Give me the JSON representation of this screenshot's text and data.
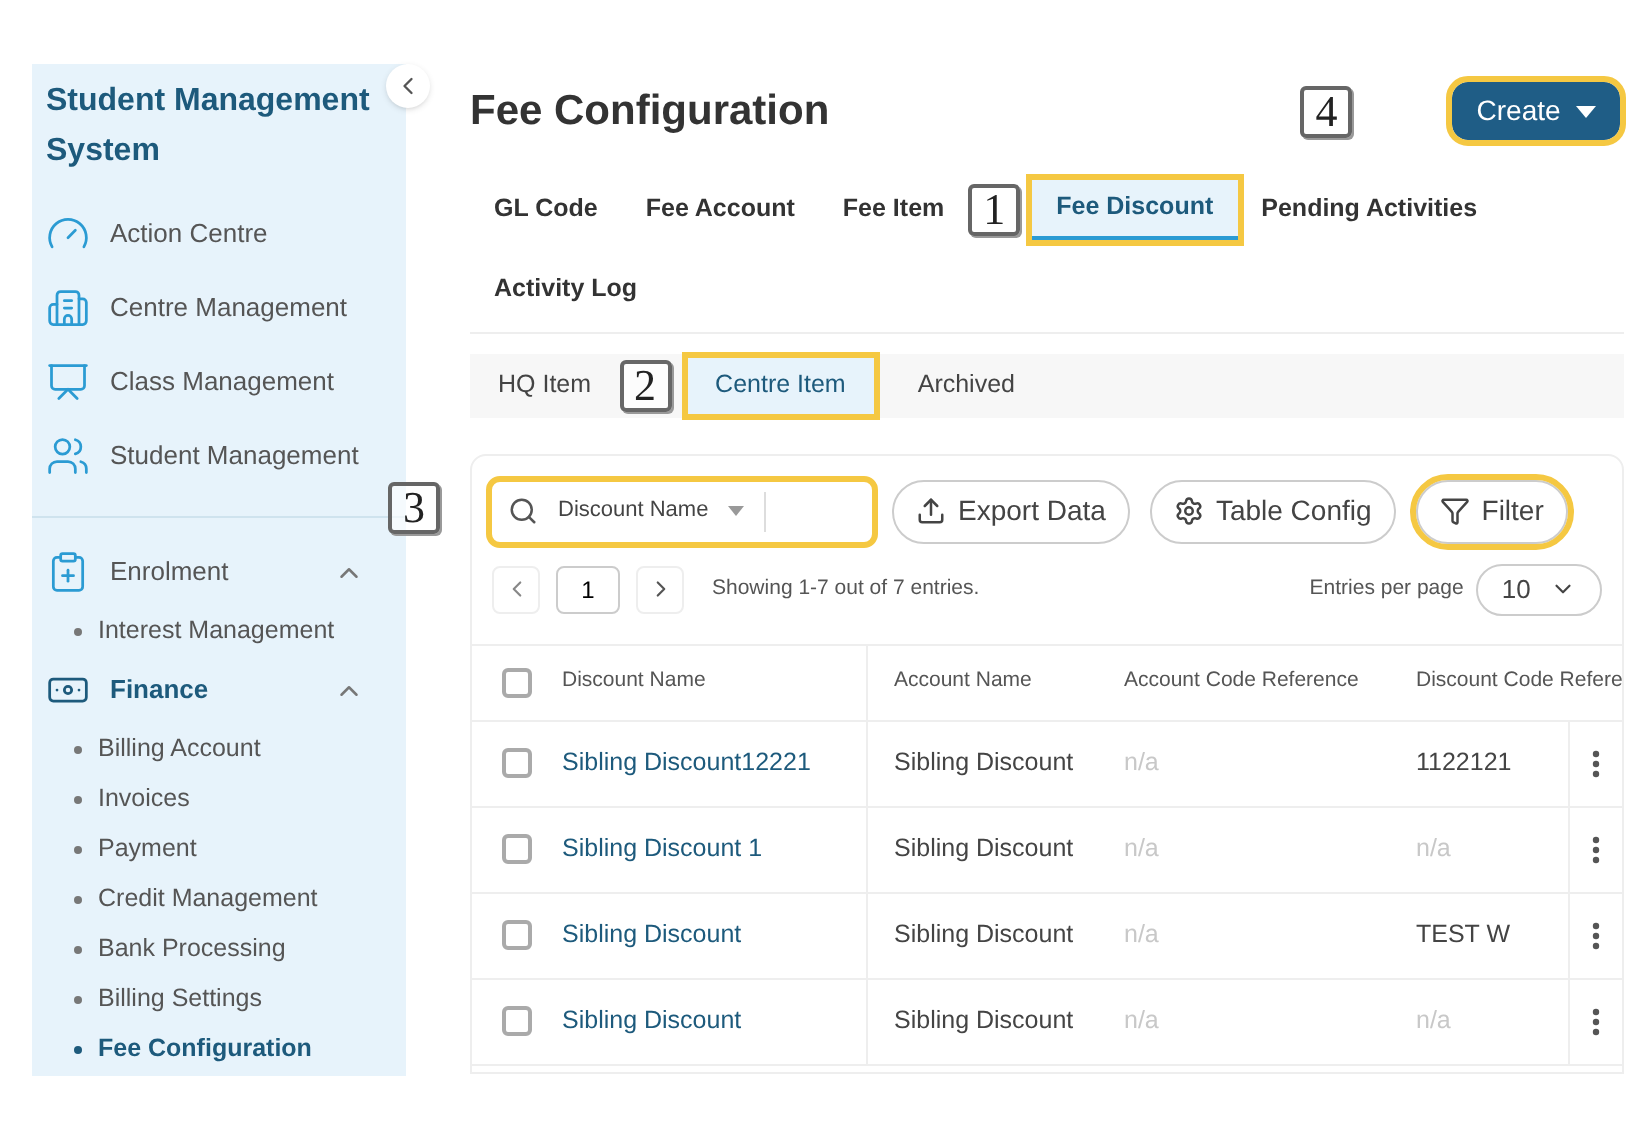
{
  "sidebar": {
    "title": "Student Management System",
    "items": [
      {
        "label": "Action Centre",
        "selected": false
      },
      {
        "label": "Centre Management",
        "selected": false
      },
      {
        "label": "Class Management",
        "selected": false
      },
      {
        "label": "Student Management",
        "selected": false
      }
    ],
    "groups": [
      {
        "label": "Enrolment",
        "selected": false,
        "expanded": true,
        "children": [
          {
            "label": "Interest Management",
            "selected": false
          }
        ]
      },
      {
        "label": "Finance",
        "selected": true,
        "expanded": true,
        "children": [
          {
            "label": "Billing Account",
            "selected": false
          },
          {
            "label": "Invoices",
            "selected": false
          },
          {
            "label": "Payment",
            "selected": false
          },
          {
            "label": "Credit Management",
            "selected": false
          },
          {
            "label": "Bank Processing",
            "selected": false
          },
          {
            "label": "Billing Settings",
            "selected": false
          },
          {
            "label": "Fee Configuration",
            "selected": true
          }
        ]
      }
    ]
  },
  "page_title": "Fee Configuration",
  "create_button": {
    "label": "Create",
    "highlighted": true,
    "callout": "4"
  },
  "tabs": [
    {
      "label": "GL Code",
      "selected": false,
      "highlighted": false
    },
    {
      "label": "Fee Account",
      "selected": false,
      "highlighted": false
    },
    {
      "label": "Fee Item",
      "selected": false,
      "highlighted": false,
      "callout": "1"
    },
    {
      "label": "Fee Discount",
      "selected": true,
      "highlighted": true
    },
    {
      "label": "Pending Activities",
      "selected": false,
      "highlighted": false
    },
    {
      "label": "Activity Log",
      "selected": false,
      "highlighted": false
    }
  ],
  "subtabs": [
    {
      "label": "HQ Item",
      "selected": false,
      "highlighted": false,
      "callout": "2"
    },
    {
      "label": "Centre Item",
      "selected": true,
      "highlighted": true
    },
    {
      "label": "Archived",
      "selected": false,
      "highlighted": false
    }
  ],
  "search": {
    "field": "Discount Name",
    "highlighted": true,
    "callout": "3"
  },
  "toolbar_buttons": [
    {
      "label": "Export Data",
      "highlighted": false
    },
    {
      "label": "Table Config",
      "highlighted": false
    },
    {
      "label": "Filter",
      "highlighted": true
    }
  ],
  "pagination": {
    "page": "1",
    "summary": "Showing 1-7 out of 7 entries.",
    "per_page_label": "Entries per page",
    "per_page": "10"
  },
  "table": {
    "all_checked": false,
    "columns": [
      "Discount Name",
      "Account Name",
      "Account Code Reference",
      "Discount Code Refere"
    ],
    "rows": [
      {
        "cells": [
          "Sibling Discount12221",
          "Sibling Discount",
          "n/a",
          "1122121"
        ],
        "checked": false
      },
      {
        "cells": [
          "Sibling Discount 1",
          "Sibling Discount",
          "n/a",
          "n/a"
        ],
        "checked": false
      },
      {
        "cells": [
          "Sibling Discount",
          "Sibling Discount",
          "n/a",
          "TEST W"
        ],
        "checked": false
      },
      {
        "cells": [
          "Sibling Discount",
          "Sibling Discount",
          "n/a",
          "n/a"
        ],
        "checked": false
      }
    ]
  }
}
